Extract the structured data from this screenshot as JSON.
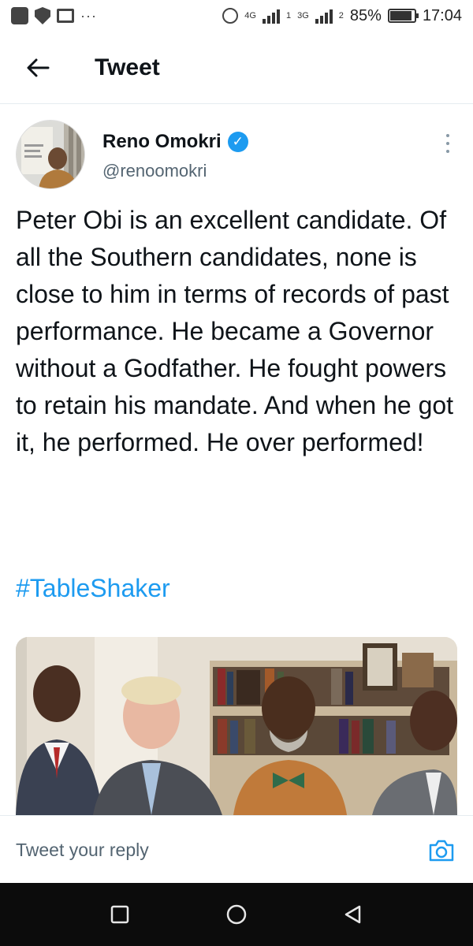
{
  "status_bar": {
    "network_4g": "4G",
    "network_3g": "3G",
    "sim1": "1",
    "sim2": "2",
    "battery": "85%",
    "time": "17:04",
    "overflow": "···"
  },
  "header": {
    "title": "Tweet"
  },
  "tweet": {
    "author_name": "Reno Omokri",
    "author_handle": "@renoomokri",
    "text": "Peter Obi is an excellent candidate. Of all the Southern candidates, none is close to him in terms of records of past performance. He became a Governor without a Godfather. He fought powers to retain his mandate. And when he got it, he performed. He over performed!",
    "hashtag": "#TableShaker"
  },
  "reply": {
    "placeholder": "Tweet your reply"
  },
  "icons": {
    "back": "arrow-left-icon",
    "verified": "verified-badge-icon",
    "more": "more-vertical-icon",
    "camera": "camera-icon",
    "recents": "square-icon",
    "home": "circle-icon",
    "back_nav": "triangle-back-icon"
  },
  "colors": {
    "accent": "#1d9bf0",
    "text": "#0f1419",
    "secondary": "#536471",
    "nav_bar": "#0c0c0c"
  }
}
